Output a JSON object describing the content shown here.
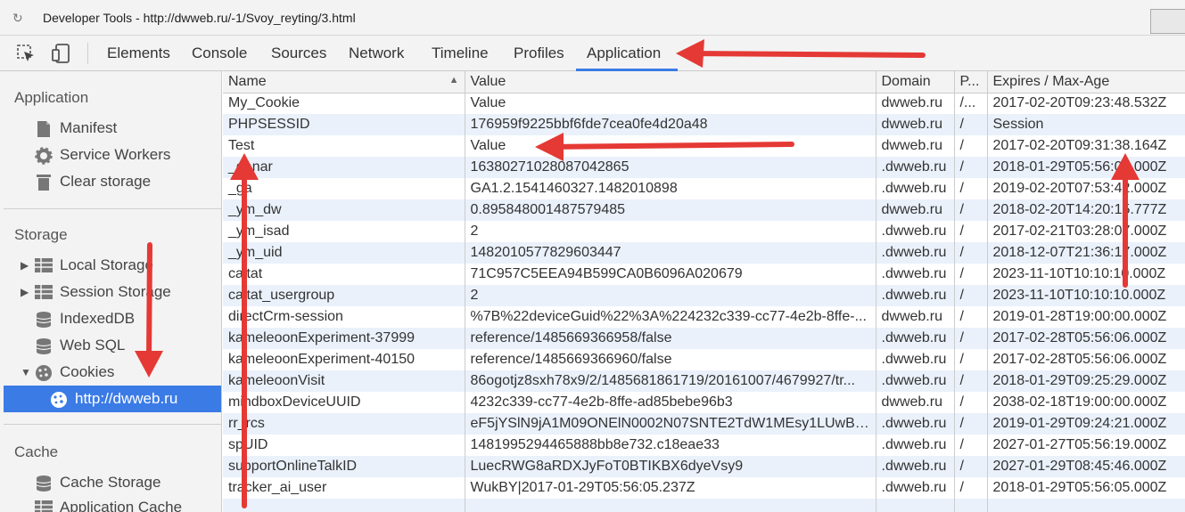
{
  "window": {
    "title": "Developer Tools - http://dwweb.ru/-1/Svoy_reyting/3.html"
  },
  "tabs": [
    {
      "label": "Elements"
    },
    {
      "label": "Console"
    },
    {
      "label": "Sources"
    },
    {
      "label": "Network"
    },
    {
      "label": "Timeline"
    },
    {
      "label": "Profiles"
    },
    {
      "label": "Application"
    }
  ],
  "active_tab": "Application",
  "sidebar": {
    "application_title": "Application",
    "application_items": [
      {
        "label": "Manifest",
        "icon": "manifest-icon"
      },
      {
        "label": "Service Workers",
        "icon": "gear-icon"
      },
      {
        "label": "Clear storage",
        "icon": "trash-icon"
      }
    ],
    "storage_title": "Storage",
    "storage_items": [
      {
        "label": "Local Storage",
        "icon": "grid-icon"
      },
      {
        "label": "Session Storage",
        "icon": "grid-icon"
      },
      {
        "label": "IndexedDB",
        "icon": "database-icon"
      },
      {
        "label": "Web SQL",
        "icon": "database-icon"
      },
      {
        "label": "Cookies",
        "icon": "cookie-icon"
      },
      {
        "label": "http://dwweb.ru",
        "icon": "cookie-icon"
      }
    ],
    "cache_title": "Cache",
    "cache_items": [
      {
        "label": "Cache Storage",
        "icon": "database-icon"
      },
      {
        "label": "Application Cache",
        "icon": "grid-icon"
      }
    ]
  },
  "table": {
    "headers": {
      "name": "Name",
      "value": "Value",
      "domain": "Domain",
      "path": "P...",
      "expires": "Expires / Max-Age"
    },
    "rows": [
      {
        "name": "My_Cookie",
        "value": "Value",
        "domain": "dwweb.ru",
        "path": "/...",
        "expires": "2017-02-20T09:23:48.532Z"
      },
      {
        "name": "PHPSESSID",
        "value": "176959f9225bbf6fde7cea0fe4d20a48",
        "domain": "dwweb.ru",
        "path": "/",
        "expires": "Session"
      },
      {
        "name": "Test",
        "value": "Value",
        "domain": "dwweb.ru",
        "path": "/",
        "expires": "2017-02-20T09:31:38.164Z"
      },
      {
        "name": "_ganar",
        "value": "16380271028087042865",
        "domain": ".dwweb.ru",
        "path": "/",
        "expires": "2018-01-29T05:56:05.000Z"
      },
      {
        "name": "_ga",
        "value": "GA1.2.1541460327.1482010898",
        "domain": ".dwweb.ru",
        "path": "/",
        "expires": "2019-02-20T07:53:42.000Z"
      },
      {
        "name": "_ym_dw",
        "value": "0.895848001487579485",
        "domain": "dwweb.ru",
        "path": "/",
        "expires": "2018-02-20T14:20:15.777Z"
      },
      {
        "name": "_ym_isad",
        "value": "2",
        "domain": ".dwweb.ru",
        "path": "/",
        "expires": "2017-02-21T03:28:07.000Z"
      },
      {
        "name": "_ym_uid",
        "value": "1482010577829603447",
        "domain": ".dwweb.ru",
        "path": "/",
        "expires": "2018-12-07T21:36:17.000Z"
      },
      {
        "name": "caltat",
        "value": "71C957C5EEA94B599CA0B6096A020679",
        "domain": ".dwweb.ru",
        "path": "/",
        "expires": "2023-11-10T10:10:10.000Z"
      },
      {
        "name": "caltat_usergroup",
        "value": "2",
        "domain": ".dwweb.ru",
        "path": "/",
        "expires": "2023-11-10T10:10:10.000Z"
      },
      {
        "name": "directCrm-session",
        "value": "%7B%22deviceGuid%22%3A%224232c339-cc77-4e2b-8ffe-...",
        "domain": "dwweb.ru",
        "path": "/",
        "expires": "2019-01-28T19:00:00.000Z"
      },
      {
        "name": "kameleoonExperiment-37999",
        "value": "reference/1485669366958/false",
        "domain": ".dwweb.ru",
        "path": "/",
        "expires": "2017-02-28T05:56:06.000Z"
      },
      {
        "name": "kameleoonExperiment-40150",
        "value": "reference/1485669366960/false",
        "domain": ".dwweb.ru",
        "path": "/",
        "expires": "2017-02-28T05:56:06.000Z"
      },
      {
        "name": "kameleoonVisit",
        "value": "86ogotjz8sxh78x9/2/1485681861719/20161007/4679927/tr...",
        "domain": ".dwweb.ru",
        "path": "/",
        "expires": "2018-01-29T09:25:29.000Z"
      },
      {
        "name": "mindboxDeviceUUID",
        "value": "4232c339-cc77-4e2b-8ffe-ad85bebe96b3",
        "domain": "dwweb.ru",
        "path": "/",
        "expires": "2038-02-18T19:00:00.000Z"
      },
      {
        "name": "rr_rcs",
        "value": "eF5jYSlN9jA1M09ONElN0002N07SNTE2TdW1MEsy1LUwBs...",
        "domain": ".dwweb.ru",
        "path": "/",
        "expires": "2019-01-29T09:24:21.000Z"
      },
      {
        "name": "spUID",
        "value": "1481995294465888bb8e732.c18eae33",
        "domain": ".dwweb.ru",
        "path": "/",
        "expires": "2027-01-27T05:56:19.000Z"
      },
      {
        "name": "supportOnlineTalkID",
        "value": "LuecRWG8aRDXJyFoT0BTIKBX6dyeVsy9",
        "domain": ".dwweb.ru",
        "path": "/",
        "expires": "2027-01-29T08:45:46.000Z"
      },
      {
        "name": "tracker_ai_user",
        "value": "WukBY|2017-01-29T05:56:05.237Z",
        "domain": ".dwweb.ru",
        "path": "/",
        "expires": "2018-01-29T05:56:05.000Z"
      },
      {
        "name": "",
        "value": "",
        "domain": "",
        "path": "",
        "expires": ""
      }
    ]
  },
  "colors": {
    "accent": "#3b7be6",
    "annotation_arrow": "#e53935",
    "row_stripe": "#eaf1fb"
  }
}
